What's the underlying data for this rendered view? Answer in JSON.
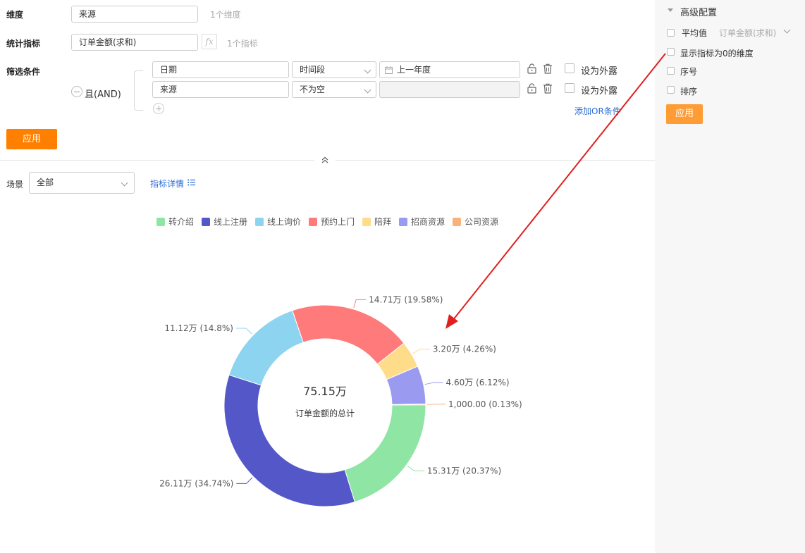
{
  "form": {
    "dimension_label": "维度",
    "dimension_value": "来源",
    "dimension_hint": "1个维度",
    "metric_label": "统计指标",
    "metric_value": "订单金额(求和)",
    "metric_fx": "fx",
    "metric_hint": "1个指标",
    "filter_label": "筛选条件",
    "logic": "且(AND)",
    "conditions": [
      {
        "field": "日期",
        "op": "时间段",
        "value": "上一年度",
        "expose": "设为外露"
      },
      {
        "field": "来源",
        "op": "不为空",
        "value": "",
        "expose": "设为外露"
      }
    ],
    "add_or": "添加OR条件",
    "apply": "应用"
  },
  "toolbar": {
    "scene_label": "场景",
    "scene_value": "全部",
    "detail_link": "指标详情"
  },
  "side": {
    "title": "高级配置",
    "avg_label": "平均值",
    "avg_value": "订单金额(求和)",
    "show_zero": "显示指标为0的维度",
    "index": "序号",
    "sort": "排序",
    "apply": "应用"
  },
  "colors": {
    "accent": "#ff8000",
    "side_accent": "#ff9c33",
    "link": "#2a6bd6",
    "arrow": "#e02020"
  },
  "chart_data": {
    "type": "pie",
    "center_value": "75.15万",
    "center_label": "订单金额的总计",
    "legend_position": "top",
    "slices": [
      {
        "name": "转介绍",
        "value": 15.31,
        "label": "15.31万 (20.37%)",
        "color": "#8fe5a4"
      },
      {
        "name": "线上注册",
        "value": 26.11,
        "label": "26.11万 (34.74%)",
        "color": "#5457c8"
      },
      {
        "name": "线上询价",
        "value": 11.12,
        "label": "11.12万 (14.8%)",
        "color": "#8dd4f0"
      },
      {
        "name": "预约上门",
        "value": 14.71,
        "label": "14.71万 (19.58%)",
        "color": "#ff7b7b"
      },
      {
        "name": "陪拜",
        "value": 3.2,
        "label": "3.20万 (4.26%)",
        "color": "#ffdc8a"
      },
      {
        "name": "招商资源",
        "value": 4.6,
        "label": "4.60万 (6.12%)",
        "color": "#9a9bf0"
      },
      {
        "name": "公司资源",
        "value": 0.1,
        "label": "1,000.00 (0.13%)",
        "color": "#f8b37a"
      }
    ]
  }
}
